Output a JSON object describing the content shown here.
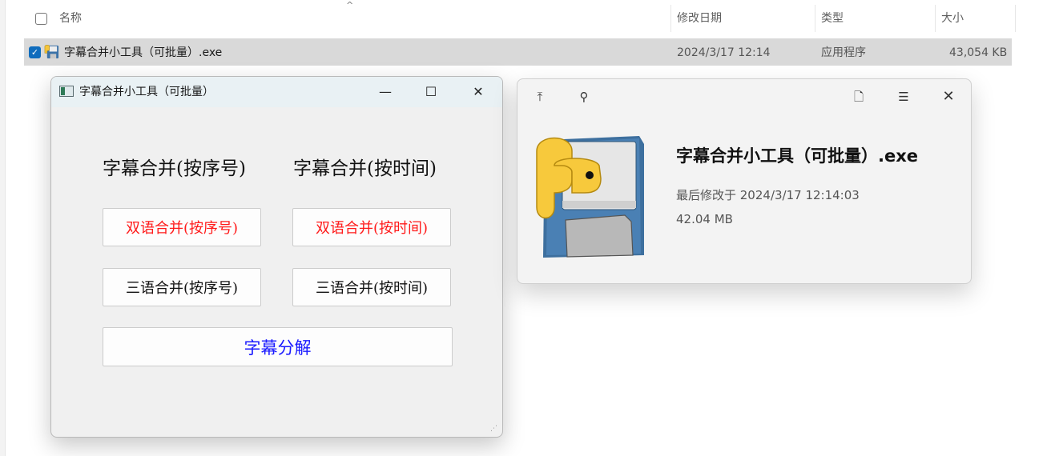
{
  "explorer": {
    "columns": {
      "name": "名称",
      "modified": "修改日期",
      "type": "类型",
      "size": "大小"
    },
    "sort_indicator": "^",
    "file": {
      "name": "字幕合并小工具（可批量）.exe",
      "modified": "2024/3/17 12:14",
      "type": "应用程序",
      "size": "43,054 KB",
      "checked": true
    }
  },
  "app": {
    "title": "字幕合并小工具（可批量）",
    "controls": {
      "minimize": "—",
      "maximize": "☐",
      "close": "✕"
    },
    "headings": {
      "by_number": "字幕合并(按序号)",
      "by_time": "字幕合并(按时间)"
    },
    "buttons": {
      "bilingual_number": "双语合并(按序号)",
      "bilingual_time": "双语合并(按时间)",
      "trilingual_number": "三语合并(按序号)",
      "trilingual_time": "三语合并(按时间)",
      "split": "字幕分解"
    },
    "colors": {
      "red": "#ff1a1a",
      "blue": "#1a1aff"
    }
  },
  "preview": {
    "file_name": "字幕合并小工具（可批量）.exe",
    "modified": "最后修改于 2024/3/17 12:14:03",
    "size": "42.04 MB",
    "icons": [
      "move-top-icon",
      "pin-icon",
      "open-file-icon",
      "details-icon",
      "close-icon"
    ]
  }
}
